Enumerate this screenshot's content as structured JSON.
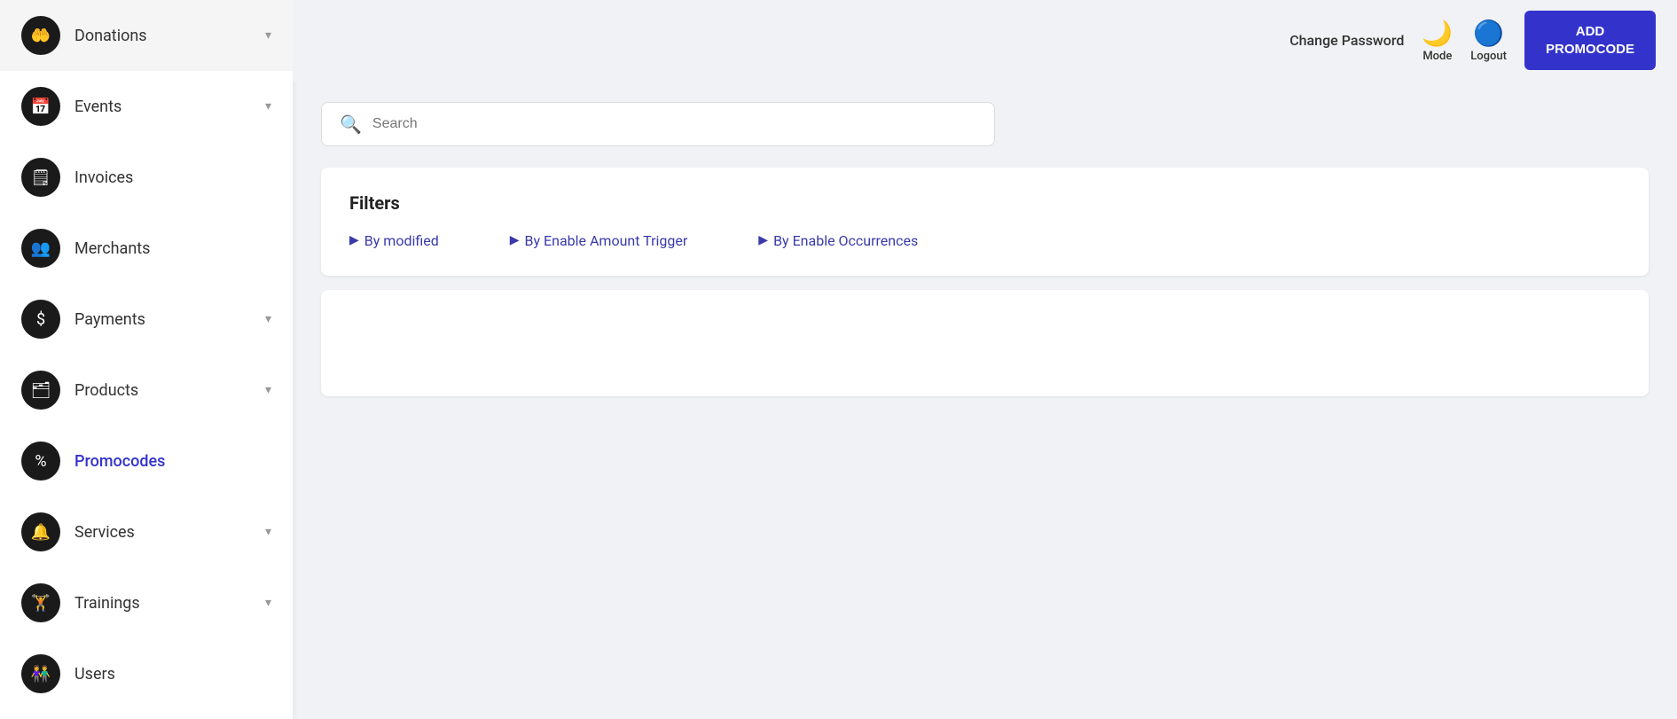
{
  "topbar": {
    "change_password_label": "Change Password",
    "mode_label": "Mode",
    "logout_label": "Logout",
    "add_promocode_label": "ADD\nPROMOCODE"
  },
  "sidebar": {
    "items": [
      {
        "id": "donations",
        "label": "Donations",
        "icon": "🤲",
        "has_chevron": true
      },
      {
        "id": "events",
        "label": "Events",
        "icon": "📅",
        "has_chevron": true
      },
      {
        "id": "invoices",
        "label": "Invoices",
        "icon": "🧾",
        "has_chevron": false
      },
      {
        "id": "merchants",
        "label": "Merchants",
        "icon": "👥",
        "has_chevron": false
      },
      {
        "id": "payments",
        "label": "Payments",
        "icon": "💲",
        "has_chevron": true
      },
      {
        "id": "products",
        "label": "Products",
        "icon": "🗂",
        "has_chevron": true
      },
      {
        "id": "promocodes",
        "label": "Promocodes",
        "icon": "%",
        "has_chevron": false,
        "active": true
      },
      {
        "id": "services",
        "label": "Services",
        "icon": "🔔",
        "has_chevron": true
      },
      {
        "id": "trainings",
        "label": "Trainings",
        "icon": "🏋",
        "has_chevron": true
      },
      {
        "id": "users",
        "label": "Users",
        "icon": "👫",
        "has_chevron": false
      }
    ]
  },
  "search": {
    "placeholder": "Search"
  },
  "filters": {
    "title": "Filters",
    "items": [
      {
        "id": "by-modified",
        "label": "By modified"
      },
      {
        "id": "by-enable-amount-trigger",
        "label": "By Enable Amount Trigger"
      },
      {
        "id": "by-enable-occurrences",
        "label": "By Enable Occurrences"
      }
    ]
  }
}
